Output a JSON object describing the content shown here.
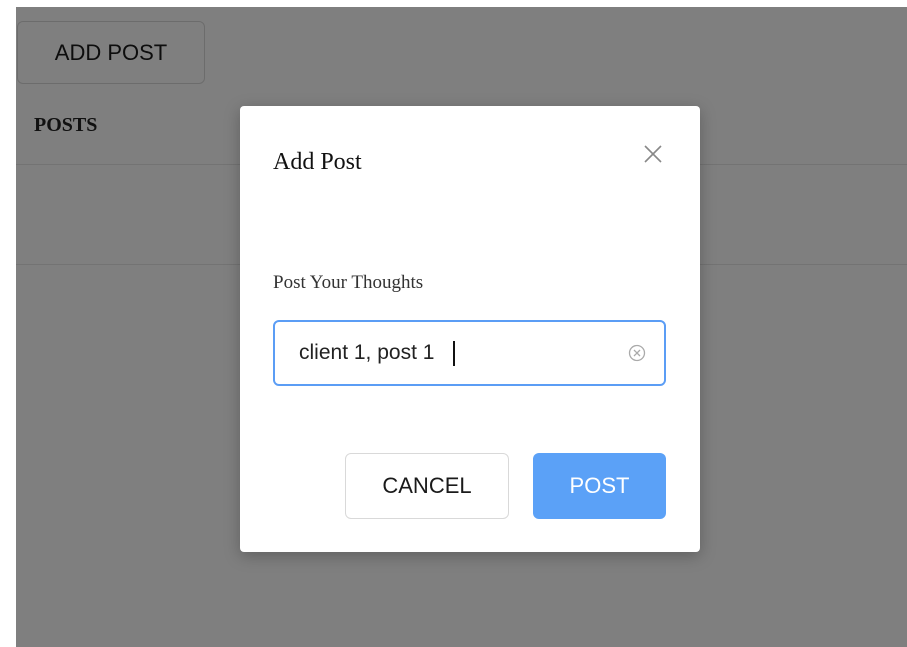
{
  "page": {
    "add_post_label": "ADD POST",
    "posts_heading": "POSTS"
  },
  "modal": {
    "title": "Add Post",
    "field_label": "Post Your Thoughts",
    "input_value": "client 1, post 1",
    "cancel_label": "CANCEL",
    "post_label": "POST",
    "close_icon": "close-icon",
    "clear_icon": "clear-input-icon"
  },
  "colors": {
    "overlay": "#808080",
    "primary": "#5ba1f7",
    "input_focus_border": "#5b9df5"
  }
}
